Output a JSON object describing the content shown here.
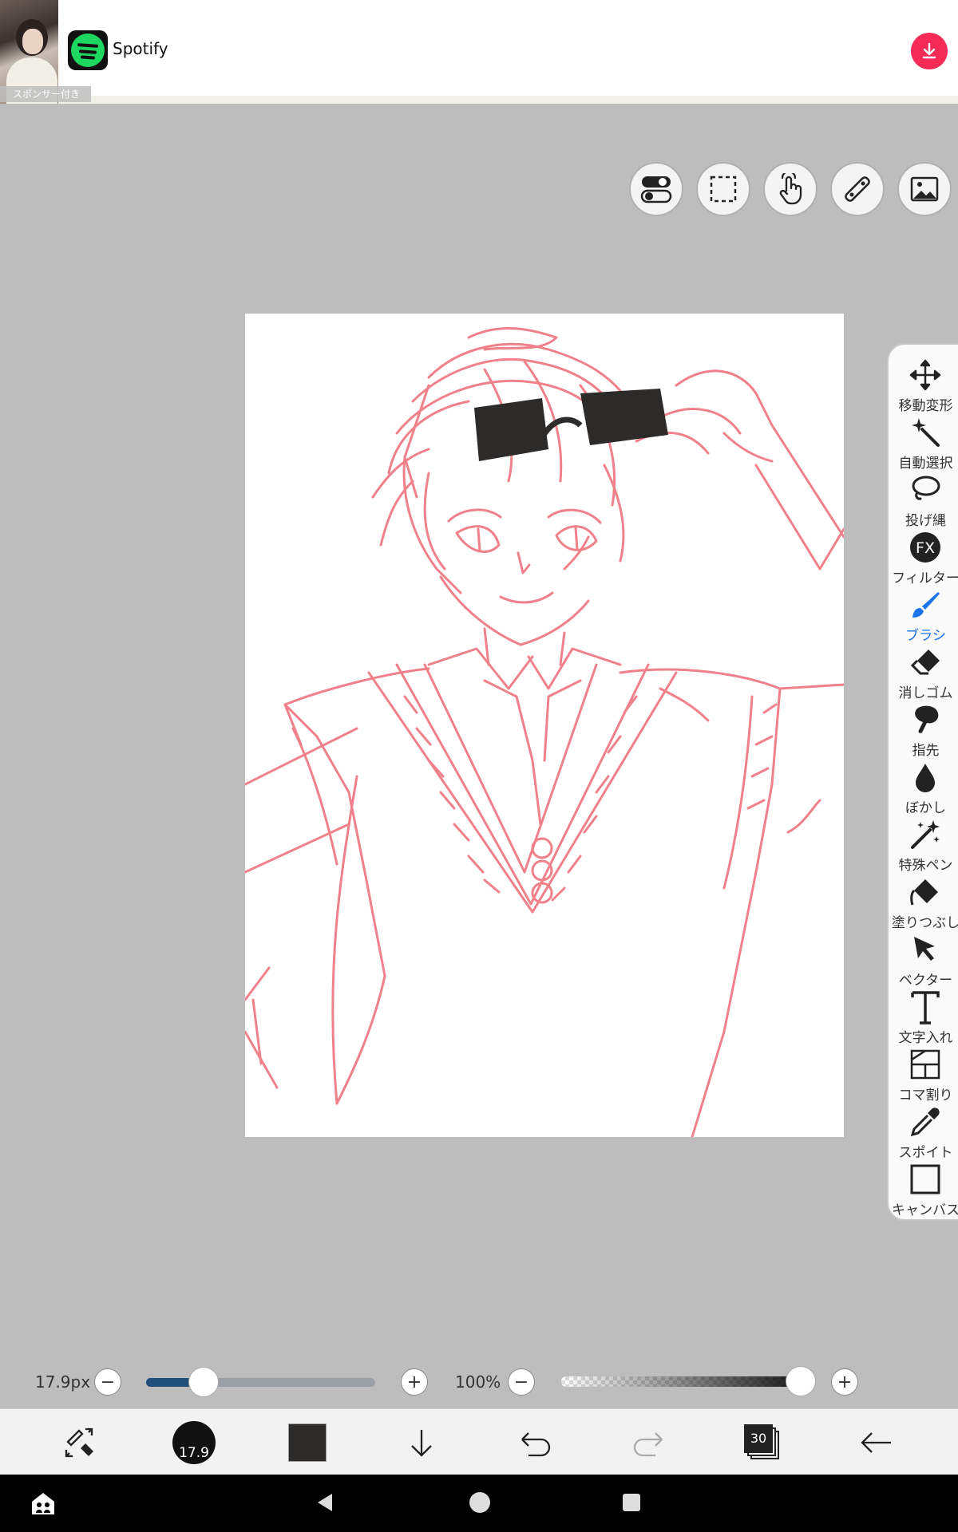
{
  "ad": {
    "sponsor_label": "スポンサー付き",
    "title": "Spotify",
    "brand_color": "#1ED760",
    "download_color": "#F52A57"
  },
  "top_tools": [
    {
      "name": "toggle-settings",
      "icon": "toggle-icon"
    },
    {
      "name": "selection",
      "icon": "marquee-select-icon"
    },
    {
      "name": "hand",
      "icon": "hand-tap-icon"
    },
    {
      "name": "ruler",
      "icon": "ruler-icon"
    },
    {
      "name": "material",
      "icon": "image-icon"
    }
  ],
  "palette": {
    "tools": [
      {
        "label": "移動変形",
        "icon": "move-arrows-icon"
      },
      {
        "label": "自動選択",
        "icon": "magic-wand-icon"
      },
      {
        "label": "投げ縄",
        "icon": "lasso-icon"
      },
      {
        "label": "フィルター",
        "icon": "fx-icon"
      },
      {
        "label": "ブラシ",
        "icon": "brush-icon",
        "active": true
      },
      {
        "label": "消しゴム",
        "icon": "eraser-icon"
      },
      {
        "label": "指先",
        "icon": "smudge-finger-icon"
      },
      {
        "label": "ぼかし",
        "icon": "blur-drop-icon"
      },
      {
        "label": "特殊ペン",
        "icon": "special-pen-icon"
      },
      {
        "label": "塗りつぶし",
        "icon": "fill-bucket-icon"
      },
      {
        "label": "ベクター",
        "icon": "vector-cursor-icon"
      },
      {
        "label": "文字入れ",
        "icon": "text-icon"
      },
      {
        "label": "コマ割り",
        "icon": "panel-divide-icon"
      },
      {
        "label": "スポイト",
        "icon": "eyedropper-icon"
      },
      {
        "label": "キャンバス",
        "icon": "canvas-icon"
      }
    ],
    "active_color": "#1A73E8"
  },
  "controls": {
    "brush_size": "17.9px",
    "brush_size_fraction": 0.25,
    "opacity": "100%",
    "opacity_fraction": 1.0,
    "minus": "−",
    "plus": "+"
  },
  "bottom_bar": {
    "brush_size_badge": "17.9",
    "current_color": "#2D2A2A",
    "layer_count": "30"
  },
  "sketch_color": "#F0808A"
}
